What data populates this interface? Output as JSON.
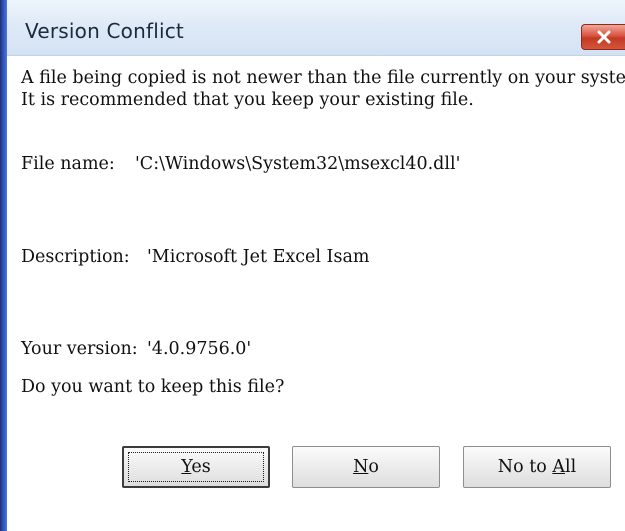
{
  "window": {
    "title": "Version Conflict"
  },
  "message": {
    "line1": "A file being copied is not newer than the file currently on your system.",
    "line2": "It is recommended that you keep your existing file."
  },
  "file": {
    "label": "File name:",
    "value": "'C:\\Windows\\System32\\msexcl40.dll'"
  },
  "description": {
    "label": "Description:",
    "value": "'Microsoft Jet Excel Isam"
  },
  "version": {
    "label": "Your version:",
    "value": "'4.0.9756.0'"
  },
  "question": "Do you want to keep this file?",
  "buttons": {
    "yes": {
      "mnemonic": "Y",
      "rest": "es"
    },
    "no": {
      "mnemonic": "N",
      "rest": "o"
    },
    "no_to_all": {
      "prefix": "No to ",
      "mnemonic": "A",
      "rest": "ll"
    }
  },
  "icons": {
    "close": "close-icon"
  },
  "colors": {
    "close_button": "#c23a23",
    "title_bar": "#dfeaf7",
    "window_frame": "#2a47a3"
  }
}
